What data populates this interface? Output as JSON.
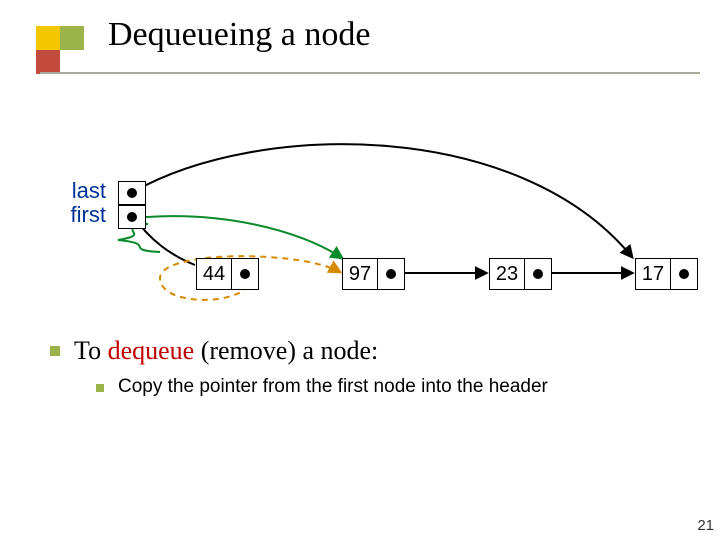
{
  "title": "Dequeueing a node",
  "header_labels": {
    "last": "last",
    "first": "first"
  },
  "nodes": [
    {
      "value": "44"
    },
    {
      "value": "97"
    },
    {
      "value": "23"
    },
    {
      "value": "17"
    }
  ],
  "bullet_main_prefix": "To ",
  "bullet_main_action": "dequeue",
  "bullet_main_suffix": " (remove) a node:",
  "bullet_sub": "Copy the pointer from the first node into the header",
  "slide_number": "21",
  "chart_data": {
    "type": "table",
    "title": "Singly-linked queue with header pointers (dequeue operation)",
    "header_pointers": [
      {
        "name": "last",
        "points_to_node_index": 3
      },
      {
        "name": "first",
        "points_to_node_index": 0,
        "being_updated_to_index": 1
      }
    ],
    "linked_list": [
      {
        "index": 0,
        "value": 44,
        "next": 1,
        "status": "being_removed"
      },
      {
        "index": 1,
        "value": 97,
        "next": 2
      },
      {
        "index": 2,
        "value": 23,
        "next": 3
      },
      {
        "index": 3,
        "value": 17,
        "next": null
      }
    ],
    "arrows": [
      {
        "kind": "pointer",
        "from": "last",
        "to_node": 3,
        "color": "black"
      },
      {
        "kind": "pointer_old",
        "from": "first",
        "to_node": 0,
        "color": "black",
        "style": "scribbled_out"
      },
      {
        "kind": "pointer_new",
        "from": "first",
        "to_node": 1,
        "color": "green"
      },
      {
        "kind": "next",
        "from_node": 0,
        "to_node": 1,
        "color": "orange",
        "style": "dashed"
      },
      {
        "kind": "next",
        "from_node": 1,
        "to_node": 2,
        "color": "black"
      },
      {
        "kind": "next",
        "from_node": 2,
        "to_node": 3,
        "color": "black"
      }
    ]
  }
}
